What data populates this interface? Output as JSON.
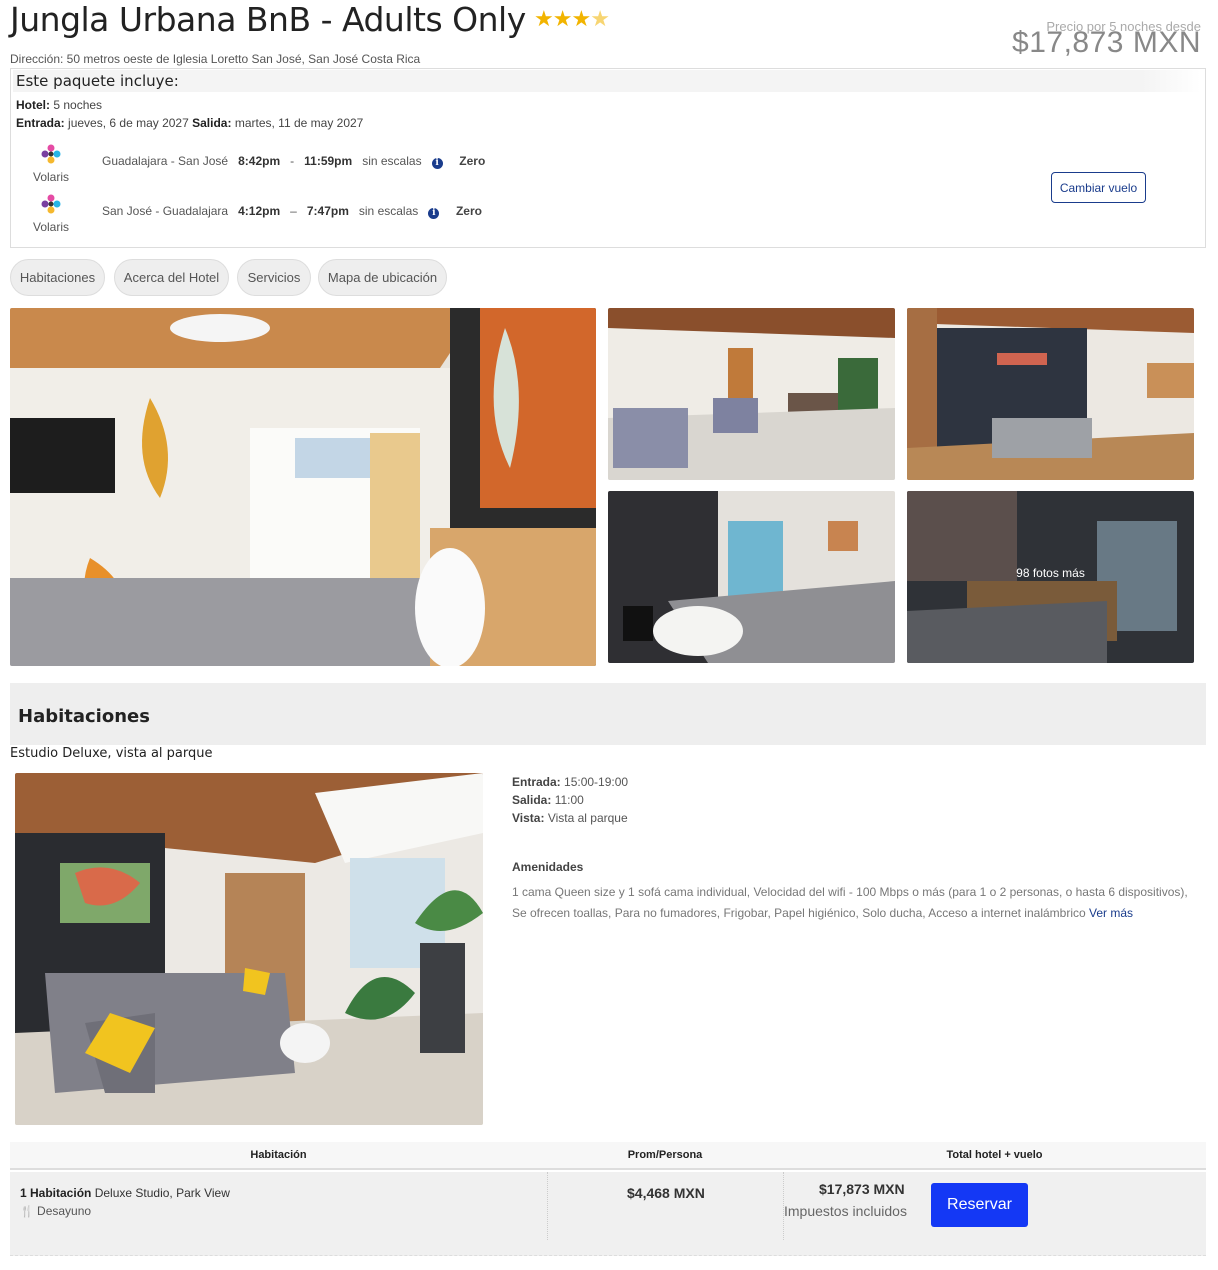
{
  "hotel": {
    "name": "Jungla Urbana BnB - Adults Only",
    "rating": 3.5,
    "address": "Dirección: 50 metros oeste de Iglesia Loretto San José, San José Costa Rica"
  },
  "price": {
    "label": "Precio por 5 noches desde",
    "amount": "$17,873 MXN"
  },
  "package": {
    "title": "Este paquete incluye:",
    "hotel_label": "Hotel:",
    "hotel_value": "5 noches",
    "checkin_label": "Entrada:",
    "checkin_value": "jueves, 6 de may 2027",
    "checkout_label": "Salida:",
    "checkout_value": "martes, 11 de may 2027",
    "flights": [
      {
        "airline": "Volaris",
        "route": "Guadalajara - San José",
        "depart": "8:42pm",
        "separator": "-",
        "arrive": "11:59pm",
        "stops": "sin escalas",
        "fare": "Zero"
      },
      {
        "airline": "Volaris",
        "route": "San José - Guadalajara",
        "depart": "4:12pm",
        "separator": "–",
        "arrive": "7:47pm",
        "stops": "sin escalas",
        "fare": "Zero"
      }
    ],
    "change_flight": "Cambiar vuelo"
  },
  "tabs": [
    "Habitaciones",
    "Acerca del Hotel",
    "Servicios",
    "Mapa de ubicación"
  ],
  "gallery": {
    "more_photos": "98 fotos más"
  },
  "rooms_section": {
    "title": "Habitaciones",
    "room_name": "Estudio Deluxe, vista al parque",
    "checkin_label": "Entrada:",
    "checkin_value": "15:00-19:00",
    "checkout_label": "Salida:",
    "checkout_value": "11:00",
    "view_label": "Vista:",
    "view_value": "Vista al parque",
    "amenities_title": "Amenidades",
    "amenities_text": "1 cama Queen size y 1 sofá cama individual, Velocidad del wifi - 100 Mbps o más (para 1 o 2 personas, o hasta 6 dispositivos), Se ofrecen toallas, Para no fumadores, Frigobar, Papel higiénico, Solo ducha, Acceso a internet inalámbrico",
    "see_more": "Ver más"
  },
  "table": {
    "headers": [
      "Habitación",
      "Prom/Persona",
      "Total hotel + vuelo"
    ],
    "row": {
      "room_qty": "1 Habitación",
      "room_type": "Deluxe Studio, Park View",
      "meal": "Desayuno",
      "per_person": "$4,468 MXN",
      "total": "$17,873 MXN",
      "taxes": "Impuestos incluidos",
      "book": "Reservar"
    }
  },
  "colors": {
    "accent": "#1a3c8c",
    "book_button": "#1438f5",
    "stars": "#f2b400"
  }
}
